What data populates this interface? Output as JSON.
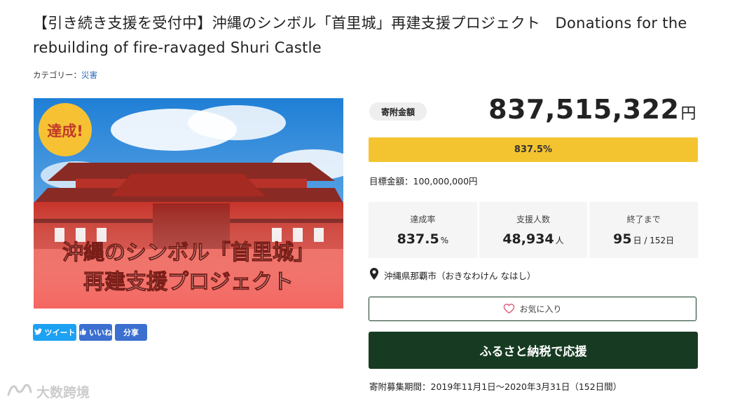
{
  "title": "【引き続き支援を受付中】沖縄のシンボル「首里城」再建支援プロジェクト　Donations for the rebuilding of fire-ravaged Shuri Castle",
  "category": {
    "prefix": "カテゴリー：",
    "link": "災害"
  },
  "hero": {
    "badge": "達成!",
    "line1": "沖縄のシンボル「首里城」",
    "line2": "再建支援プロジェクト"
  },
  "share": {
    "tweet": "ツイート",
    "like": "いいね",
    "share": "分享"
  },
  "donation": {
    "pill": "寄附金額",
    "amount": "837,515,322",
    "yen": "円",
    "progress_label": "837.5%",
    "progress_fraction": 1.0,
    "goal": "目標金額：100,000,000円"
  },
  "stats": [
    {
      "label": "達成率",
      "value": "837.5",
      "unit": "%"
    },
    {
      "label": "支援人数",
      "value": "48,934",
      "unit": "人"
    },
    {
      "label": "終了まで",
      "value": "95",
      "unit": "日 / 152日"
    }
  ],
  "location": "沖縄県那覇市（おきなわけん なはし）",
  "favorite": "お気に入り",
  "cta": "ふるさと納税で応援",
  "period": "寄附募集期間：2019年11月1日〜2020年3月31日（152日間）",
  "watermark": "大数跨境",
  "colors": {
    "accent_green": "#173b22",
    "progress_yellow": "#f4c430",
    "link_blue": "#2563b8"
  }
}
